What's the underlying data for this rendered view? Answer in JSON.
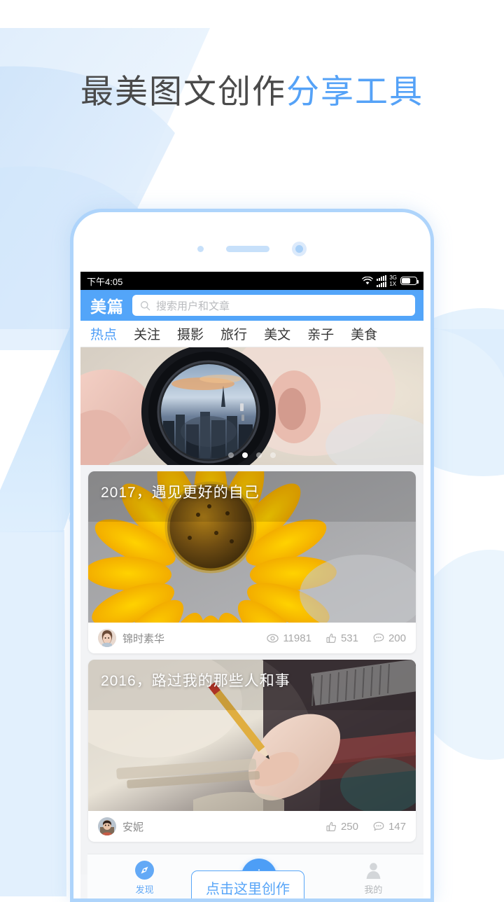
{
  "promo": {
    "headline_dark": "最美图文创作",
    "headline_blue": "分享工具"
  },
  "colors": {
    "accent": "#53a5f9",
    "headline_dark": "#4a4a4a",
    "headline_blue": "#55a2f7",
    "frame": "#aed4fb",
    "fab": "#4d9ef6"
  },
  "phone": {
    "statusbar": {
      "time": "下午4:05",
      "wifi_icon": "wifi-icon",
      "signal_label_1": "3G",
      "signal_label_2": "1X",
      "battery_icon": "battery-icon"
    },
    "header": {
      "logo": "美篇",
      "search_icon": "search-icon",
      "search_value": "",
      "search_placeholder": "搜索用户和文章"
    },
    "tabs": [
      {
        "label": "热点",
        "active": true
      },
      {
        "label": "关注",
        "active": false
      },
      {
        "label": "摄影",
        "active": false
      },
      {
        "label": "旅行",
        "active": false
      },
      {
        "label": "美文",
        "active": false
      },
      {
        "label": "亲子",
        "active": false
      },
      {
        "label": "美食",
        "active": false
      }
    ],
    "banner": {
      "name": "camera-lens-banner",
      "dot_count": 4,
      "active_dot": 2
    },
    "cards": [
      {
        "title": "2017，遇见更好的自己",
        "author": "锦时素华",
        "views": "11981",
        "likes": "531",
        "comments": "200",
        "views_icon": "eye-icon",
        "likes_icon": "thumbs-up-icon",
        "comments_icon": "comment-icon"
      },
      {
        "title": "2016，路过我的那些人和事",
        "author": "安妮",
        "views": "",
        "likes": "250",
        "comments": "147",
        "likes_icon": "thumbs-up-icon",
        "comments_icon": "comment-icon"
      }
    ],
    "tooltip": {
      "text": "点击这里创作"
    },
    "bottomnav": {
      "discover_label": "发现",
      "discover_icon": "compass-icon",
      "create_icon": "plus-icon",
      "mine_label": "我的",
      "mine_icon": "person-icon"
    }
  }
}
